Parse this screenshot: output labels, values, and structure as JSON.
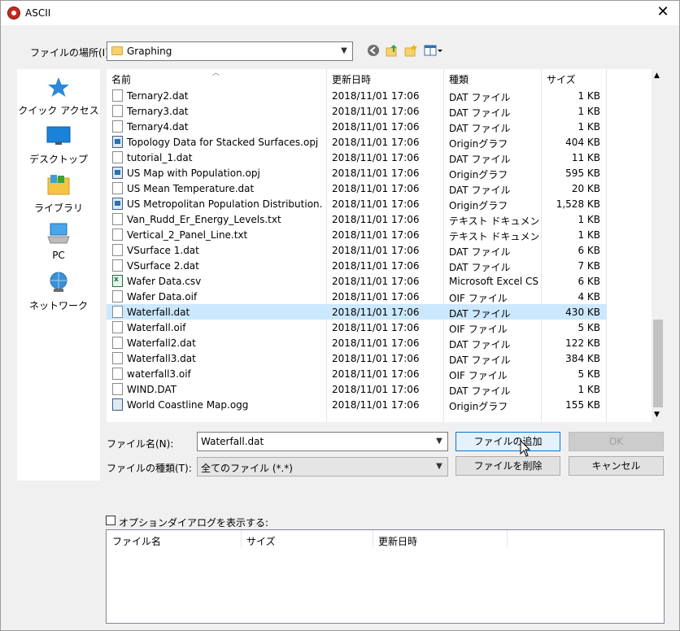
{
  "window": {
    "title": "ASCII",
    "close_glyph": "✕"
  },
  "location": {
    "label": "ファイルの場所(I):",
    "value": "Graphing"
  },
  "places": [
    {
      "label": "クイック アクセス",
      "icon": "quick-access-star-icon"
    },
    {
      "label": "デスクトップ",
      "icon": "desktop-icon"
    },
    {
      "label": "ライブラリ",
      "icon": "library-icon"
    },
    {
      "label": "PC",
      "icon": "pc-icon"
    },
    {
      "label": "ネットワーク",
      "icon": "network-icon"
    }
  ],
  "columns": {
    "name": "名前",
    "date": "更新日時",
    "type": "種類",
    "size": "サイズ"
  },
  "files": [
    {
      "name": "Ternary2.dat",
      "date": "2018/11/01 17:06",
      "type": "DAT ファイル",
      "size": "1 KB",
      "icon": "dat"
    },
    {
      "name": "Ternary3.dat",
      "date": "2018/11/01 17:06",
      "type": "DAT ファイル",
      "size": "1 KB",
      "icon": "dat"
    },
    {
      "name": "Ternary4.dat",
      "date": "2018/11/01 17:06",
      "type": "DAT ファイル",
      "size": "1 KB",
      "icon": "dat"
    },
    {
      "name": "Topology Data for Stacked Surfaces.opj",
      "date": "2018/11/01 17:06",
      "type": "Originグラフ",
      "size": "404 KB",
      "icon": "opj"
    },
    {
      "name": "tutorial_1.dat",
      "date": "2018/11/01 17:06",
      "type": "DAT ファイル",
      "size": "11 KB",
      "icon": "dat"
    },
    {
      "name": "US Map with Population.opj",
      "date": "2018/11/01 17:06",
      "type": "Originグラフ",
      "size": "595 KB",
      "icon": "opj"
    },
    {
      "name": "US Mean Temperature.dat",
      "date": "2018/11/01 17:06",
      "type": "DAT ファイル",
      "size": "20 KB",
      "icon": "dat"
    },
    {
      "name": "US Metropolitan Population Distribution.opj",
      "date": "2018/11/01 17:06",
      "type": "Originグラフ",
      "size": "1,528 KB",
      "icon": "opj"
    },
    {
      "name": "Van_Rudd_Er_Energy_Levels.txt",
      "date": "2018/11/01 17:06",
      "type": "テキスト ドキュメント",
      "size": "1 KB",
      "icon": "dat"
    },
    {
      "name": "Vertical_2_Panel_Line.txt",
      "date": "2018/11/01 17:06",
      "type": "テキスト ドキュメント",
      "size": "1 KB",
      "icon": "dat"
    },
    {
      "name": "VSurface 1.dat",
      "date": "2018/11/01 17:06",
      "type": "DAT ファイル",
      "size": "6 KB",
      "icon": "dat"
    },
    {
      "name": "VSurface 2.dat",
      "date": "2018/11/01 17:06",
      "type": "DAT ファイル",
      "size": "7 KB",
      "icon": "dat"
    },
    {
      "name": "Wafer Data.csv",
      "date": "2018/11/01 17:06",
      "type": "Microsoft Excel CS...",
      "size": "6 KB",
      "icon": "csv"
    },
    {
      "name": "Wafer Data.oif",
      "date": "2018/11/01 17:06",
      "type": "OIF ファイル",
      "size": "4 KB",
      "icon": "dat"
    },
    {
      "name": "Waterfall.dat",
      "date": "2018/11/01 17:06",
      "type": "DAT ファイル",
      "size": "430 KB",
      "icon": "dat",
      "selected": true
    },
    {
      "name": "Waterfall.oif",
      "date": "2018/11/01 17:06",
      "type": "OIF ファイル",
      "size": "5 KB",
      "icon": "dat"
    },
    {
      "name": "Waterfall2.dat",
      "date": "2018/11/01 17:06",
      "type": "DAT ファイル",
      "size": "122 KB",
      "icon": "dat"
    },
    {
      "name": "Waterfall3.dat",
      "date": "2018/11/01 17:06",
      "type": "DAT ファイル",
      "size": "384 KB",
      "icon": "dat"
    },
    {
      "name": "waterfall3.oif",
      "date": "2018/11/01 17:06",
      "type": "OIF ファイル",
      "size": "5 KB",
      "icon": "dat"
    },
    {
      "name": "WIND.DAT",
      "date": "2018/11/01 17:06",
      "type": "DAT ファイル",
      "size": "1 KB",
      "icon": "dat"
    },
    {
      "name": "World Coastline Map.ogg",
      "date": "2018/11/01 17:06",
      "type": "Originグラフ",
      "size": "155 KB",
      "icon": "ogg"
    }
  ],
  "filename": {
    "label": "ファイル名(N):",
    "value": "Waterfall.dat"
  },
  "filetype": {
    "label": "ファイルの種類(T):",
    "value": "全てのファイル (*.*)"
  },
  "buttons": {
    "add": "ファイルの追加",
    "ok": "OK",
    "remove": "ファイルを削除",
    "cancel": "キャンセル"
  },
  "options": {
    "show_dialog_label": "オプションダイアログを表示する:",
    "checked": false
  },
  "bottom_columns": {
    "name": "ファイル名",
    "size": "サイズ",
    "date": "更新日時"
  },
  "colors": {
    "selection": "#cce8ff",
    "focus_border": "#0078d7",
    "folder": "#f6d26b"
  }
}
